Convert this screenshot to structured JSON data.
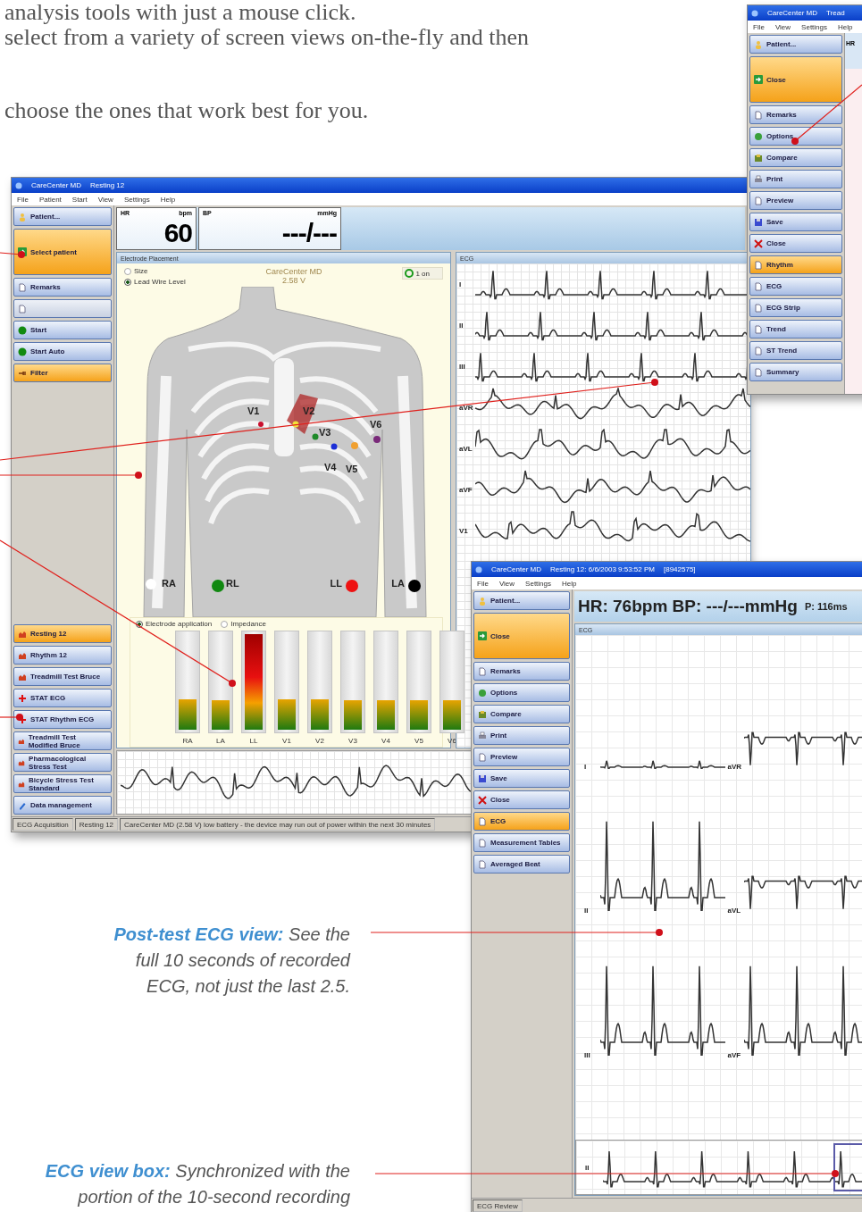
{
  "intro": [
    "analysis tools with just a mouse click.",
    "select from a variety of screen views on-the-fly and then",
    "choose the ones that work best for you."
  ],
  "acquisition_window": {
    "title": "CareCenter MD",
    "subtitle": "Resting 12",
    "menu": [
      "File",
      "Patient",
      "Start",
      "View",
      "Settings",
      "Help"
    ],
    "sidebar_top": [
      {
        "label": "Patient...",
        "kind": "small",
        "selected": false,
        "disabled": false
      },
      {
        "label": "Select patient",
        "kind": "large",
        "selected": true,
        "disabled": false
      },
      {
        "label": "Remarks",
        "kind": "small",
        "selected": false,
        "disabled": false
      },
      {
        "kind": "small",
        "selected": false,
        "disabled": true
      },
      {
        "label": "Start",
        "kind": "small",
        "selected": false,
        "disabled": false
      },
      {
        "label": "Start Auto",
        "kind": "small",
        "selected": false,
        "disabled": false
      },
      {
        "label": "Filter",
        "kind": "small",
        "selected": true,
        "disabled": false
      }
    ],
    "sidebar_bottom": [
      {
        "label": "Resting 12",
        "kind": "small",
        "selected": true,
        "disabled": false
      },
      {
        "label": "Rhythm 12",
        "kind": "small",
        "selected": false,
        "disabled": false
      },
      {
        "label": "Treadmill Test Bruce",
        "kind": "small",
        "selected": false,
        "disabled": false
      },
      {
        "label": "STAT ECG",
        "kind": "small",
        "selected": false,
        "disabled": false
      },
      {
        "label": "STAT Rhythm ECG",
        "kind": "small",
        "selected": false,
        "disabled": false
      },
      {
        "label": "Treadmill Test Modified Bruce",
        "kind": "small",
        "selected": false,
        "disabled": false
      },
      {
        "label": "Pharmacological Stress Test",
        "kind": "small",
        "selected": false,
        "disabled": false
      },
      {
        "label": "Bicycle Stress Test Standard",
        "kind": "small",
        "selected": false,
        "disabled": false
      },
      {
        "label": "Data management",
        "kind": "small",
        "selected": false,
        "disabled": false
      }
    ],
    "vitals": [
      {
        "label": "HR",
        "unit": "bpm",
        "value": "60"
      },
      {
        "label": "BP",
        "unit": "mmHg",
        "value": "---/---"
      }
    ],
    "electrode_panel": {
      "title": "Electrode Placement",
      "options": [
        {
          "label": "Size",
          "selected": false
        },
        {
          "label": "Lead Wire Level",
          "selected": true
        }
      ],
      "device": "CareCenter MD",
      "voltage": "2.58 V",
      "status": "1 on",
      "electrodes": [
        {
          "label": "V1",
          "color": "#c8102e"
        },
        {
          "label": "V2",
          "color": "#f2e33a"
        },
        {
          "label": "V3",
          "color": "#1f8a2a"
        },
        {
          "label": "V4",
          "color": "#1c2fd6"
        },
        {
          "label": "V5",
          "color": "#f0a030"
        },
        {
          "label": "V6",
          "color": "#7a2a7a"
        },
        {
          "label": "RA",
          "color": "#ffffff"
        },
        {
          "label": "RL",
          "color": "#118811"
        },
        {
          "label": "LL",
          "color": "#ee1111"
        },
        {
          "label": "LA",
          "color": "#000000"
        }
      ],
      "bar_options": [
        {
          "label": "Electrode application",
          "selected": true
        },
        {
          "label": "Impedance",
          "selected": false
        }
      ],
      "bars": [
        {
          "label": "RA",
          "level": 0.32,
          "alert": false
        },
        {
          "label": "LA",
          "level": 0.31,
          "alert": false
        },
        {
          "label": "LL",
          "level": 1,
          "alert": true
        },
        {
          "label": "V1",
          "level": 0.32,
          "alert": false
        },
        {
          "label": "V2",
          "level": 0.32,
          "alert": false
        },
        {
          "label": "V3",
          "level": 0.31,
          "alert": false
        },
        {
          "label": "V4",
          "level": 0.31,
          "alert": false
        },
        {
          "label": "V5",
          "level": 0.31,
          "alert": false
        },
        {
          "label": "V6",
          "level": 0.31,
          "alert": false
        }
      ]
    },
    "ecg_panel": {
      "title": "ECG",
      "leads": [
        "I",
        "II",
        "III",
        "aVR",
        "aVL",
        "aVF",
        "V1"
      ]
    },
    "status_bar": [
      "ECG Acquisition",
      "Resting 12",
      "CareCenter MD (2.58 V) low battery - the device may run out of power within the next 30 minutes"
    ]
  },
  "rhythm_window": {
    "title": "CareCenter MD",
    "subtitle": "Tread",
    "menu": [
      "File",
      "View",
      "Settings",
      "Help"
    ],
    "readout": "HR",
    "sidebar_top": [
      {
        "label": "Patient...",
        "kind": "small",
        "selected": false,
        "disabled": false
      },
      {
        "label": "Close",
        "kind": "large",
        "selected": true,
        "disabled": false
      },
      {
        "label": "Remarks",
        "kind": "small",
        "selected": false,
        "disabled": false
      },
      {
        "label": "Options",
        "kind": "small",
        "selected": false,
        "disabled": false
      },
      {
        "label": "Compare",
        "kind": "small",
        "selected": false,
        "disabled": false
      },
      {
        "label": "Print",
        "kind": "small",
        "selected": false,
        "disabled": false
      },
      {
        "label": "Preview",
        "kind": "small",
        "selected": false,
        "disabled": false
      },
      {
        "label": "Save",
        "kind": "small",
        "selected": false,
        "disabled": false
      },
      {
        "label": "Close",
        "kind": "small",
        "selected": false,
        "disabled": false
      }
    ],
    "sidebar_bottom": [
      {
        "label": "Rhythm",
        "kind": "small",
        "selected": true,
        "disabled": false
      },
      {
        "label": "ECG",
        "kind": "small",
        "selected": false,
        "disabled": false
      },
      {
        "label": "ECG Strip",
        "kind": "small",
        "selected": false,
        "disabled": false
      },
      {
        "label": "Trend",
        "kind": "small",
        "selected": false,
        "disabled": false
      },
      {
        "label": "ST Trend",
        "kind": "small",
        "selected": false,
        "disabled": false
      },
      {
        "label": "Summary",
        "kind": "small",
        "selected": false,
        "disabled": false
      }
    ]
  },
  "review_window": {
    "title": "CareCenter MD",
    "subtitle": "Resting 12: 6/6/2003 9:53:52 PM",
    "record": "[8942575]",
    "menu": [
      "File",
      "View",
      "Settings",
      "Help"
    ],
    "sidebar_top": [
      {
        "label": "Patient...",
        "kind": "small",
        "selected": false,
        "disabled": false
      },
      {
        "label": "Close",
        "kind": "large",
        "selected": true,
        "disabled": false
      },
      {
        "label": "Remarks",
        "kind": "small",
        "selected": false,
        "disabled": false
      },
      {
        "label": "Options",
        "kind": "small",
        "selected": false,
        "disabled": false
      },
      {
        "label": "Compare",
        "kind": "small",
        "selected": false,
        "disabled": false
      },
      {
        "label": "Print",
        "kind": "small",
        "selected": false,
        "disabled": false
      },
      {
        "label": "Preview",
        "kind": "small",
        "selected": false,
        "disabled": false
      },
      {
        "label": "Save",
        "kind": "small",
        "selected": false,
        "disabled": false
      },
      {
        "label": "Close",
        "kind": "small",
        "selected": false,
        "disabled": false
      }
    ],
    "sidebar_bottom": [
      {
        "label": "ECG",
        "kind": "small",
        "selected": true,
        "disabled": false
      },
      {
        "label": "Measurement Tables",
        "kind": "small",
        "selected": false,
        "disabled": false
      },
      {
        "label": "Averaged Beat",
        "kind": "small",
        "selected": false,
        "disabled": false
      }
    ],
    "summary": "HR: 76bpm BP: ---/---mmHg",
    "intervals": "P: 116ms",
    "ecg_panel": {
      "title": "ECG",
      "leads": [
        "I",
        "aVR",
        "II",
        "aVL",
        "III",
        "aVF"
      ]
    },
    "rhythm_strip": {
      "lead": "II"
    },
    "status_bar": [
      "ECG Review"
    ]
  },
  "callouts": [
    {
      "text": "**Post-test ECG view:** See the full 10 seconds of recorded ECG, not just the last 2.5."
    },
    {
      "text": "**ECG view box:** Synchronized with the portion of the 10-second recording"
    }
  ]
}
